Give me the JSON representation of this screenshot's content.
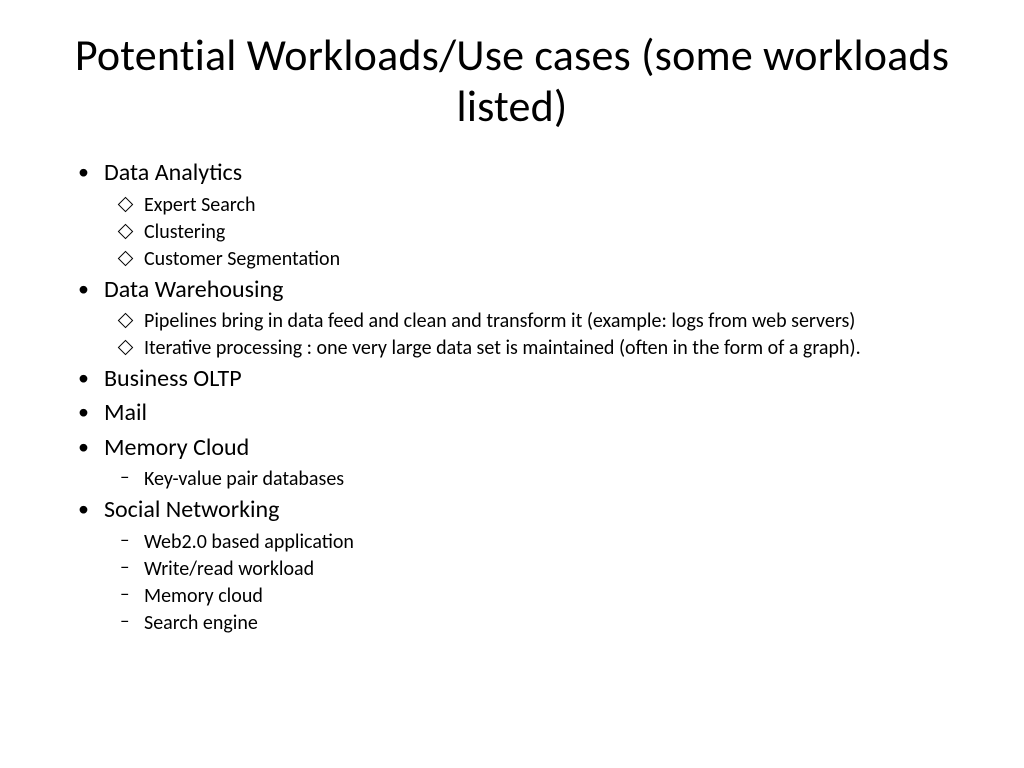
{
  "title": "Potential Workloads/Use cases (some workloads listed)",
  "items": [
    {
      "label": "Data Analytics",
      "subMarker": "diamond",
      "sub": [
        "Expert Search",
        "Clustering",
        "Customer Segmentation"
      ]
    },
    {
      "label": "Data Warehousing",
      "subMarker": "diamond",
      "sub": [
        "Pipelines bring in data feed and clean and transform it (example: logs from web servers)",
        " Iterative processing : one very large data set is maintained (often in the form of a graph)."
      ]
    },
    {
      "label": "Business OLTP"
    },
    {
      "label": "Mail"
    },
    {
      "label": "Memory Cloud",
      "subMarker": "dash",
      "sub": [
        "Key-value pair databases"
      ]
    },
    {
      "label": "Social Networking",
      "subMarker": "dash",
      "sub": [
        "Web2.0 based application",
        "Write/read workload",
        "Memory cloud",
        "Search engine"
      ]
    }
  ]
}
